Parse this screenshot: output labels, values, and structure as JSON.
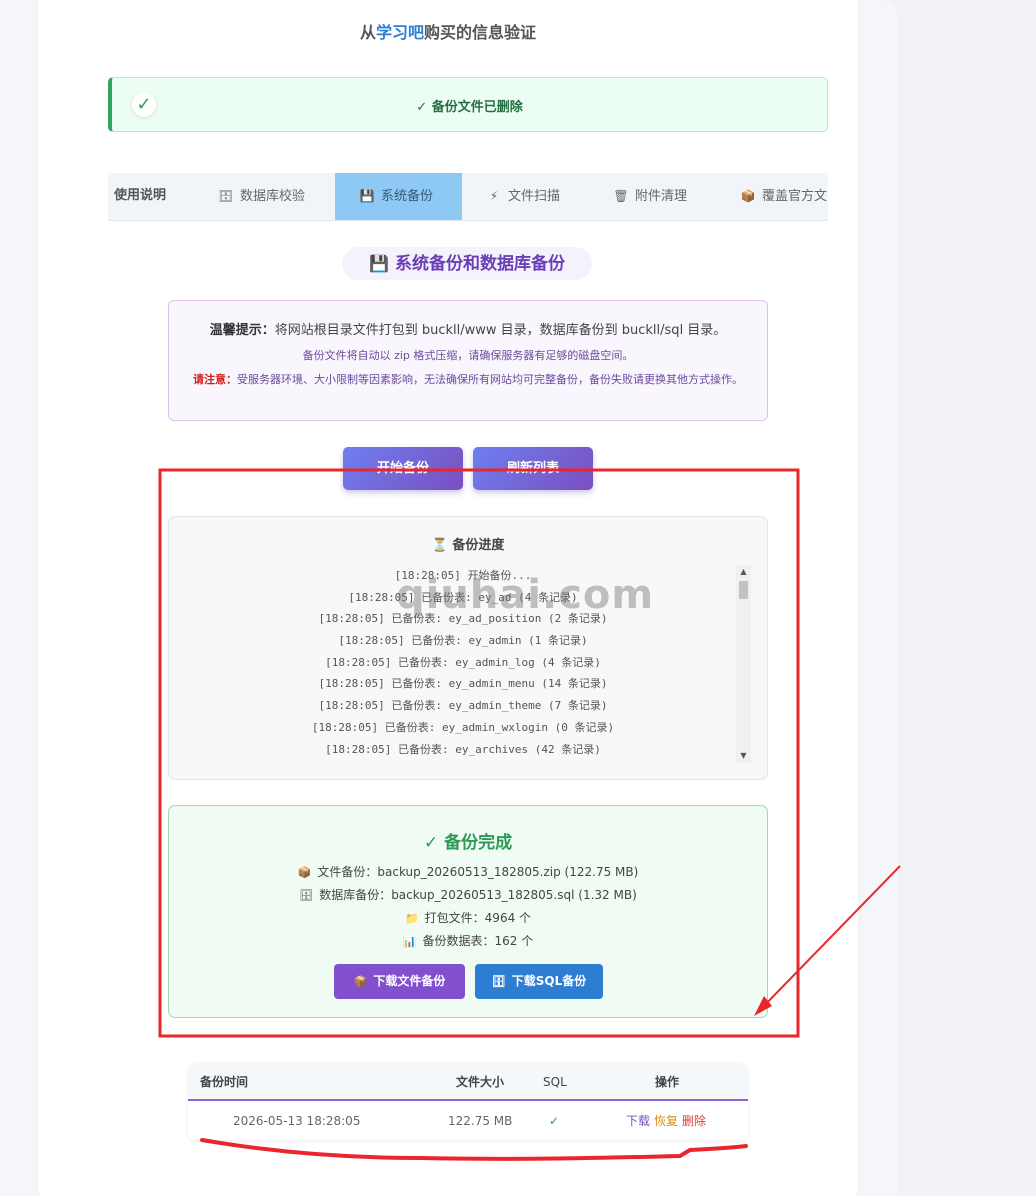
{
  "page": {
    "title_prefix": "从",
    "title_brand": "学习吧",
    "title_suffix": "购买的信息验证"
  },
  "alert": {
    "icon": "check-icon",
    "icon_glyph": "✓",
    "message": "✓ 备份文件已删除"
  },
  "tabs": [
    {
      "label": "使用说明",
      "icon": "",
      "active": false
    },
    {
      "label": "数据库校验",
      "icon": "database-icon",
      "glyph": "🗄",
      "active": false
    },
    {
      "label": "系统备份",
      "icon": "floppy-icon",
      "glyph": "💾",
      "active": true
    },
    {
      "label": "文件扫描",
      "icon": "lightning-icon",
      "glyph": "⚡",
      "active": false
    },
    {
      "label": "附件清理",
      "icon": "trash-icon",
      "glyph": "🗑",
      "active": false
    },
    {
      "label": "覆盖官方文",
      "icon": "package-icon",
      "glyph": "📦",
      "active": false
    }
  ],
  "section": {
    "glyph": "💾",
    "title": "系统备份和数据库备份"
  },
  "notice": {
    "tip_label": "温馨提示：",
    "tip_text": "将网站根目录文件打包到 buckll/www 目录，数据库备份到 buckll/sql 目录。",
    "line2": "备份文件将自动以 zip 格式压缩，请确保服务器有足够的磁盘空间。",
    "warn_label": "请注意：",
    "warn_text": "受服务器环境、大小限制等因素影响，无法确保所有网站均可完整备份，备份失败请更换其他方式操作。"
  },
  "actions": {
    "start_backup": "开始备份",
    "refresh_list": "刷新列表"
  },
  "progress": {
    "glyph": "⏳",
    "title": "备份进度",
    "log": [
      "[18:28:05] 开始备份...",
      "[18:28:05] 已备份表: ey_ad (4 条记录)",
      "[18:28:05] 已备份表: ey_ad_position (2 条记录)",
      "[18:28:05] 已备份表: ey_admin (1 条记录)",
      "[18:28:05] 已备份表: ey_admin_log (4 条记录)",
      "[18:28:05] 已备份表: ey_admin_menu (14 条记录)",
      "[18:28:05] 已备份表: ey_admin_theme (7 条记录)",
      "[18:28:05] 已备份表: ey_admin_wxlogin (0 条记录)",
      "[18:28:05] 已备份表: ey_archives (42 条记录)"
    ]
  },
  "done": {
    "title": "✓ 备份完成",
    "file_glyph": "📦",
    "file_line": "文件备份：backup_20260513_182805.zip (122.75 MB)",
    "db_glyph": "🗄",
    "db_line": "数据库备份：backup_20260513_182805.sql (1.32 MB)",
    "folder_glyph": "📁",
    "files_line": "打包文件：4964 个",
    "chart_glyph": "📊",
    "tables_line": "备份数据表：162 个",
    "download_files": "下载文件备份",
    "download_sql": "下载SQL备份"
  },
  "table": {
    "headers": {
      "time": "备份时间",
      "size": "文件大小",
      "sql": "SQL",
      "ops": "操作"
    },
    "rows": [
      {
        "time": "2026-05-13 18:28:05",
        "size": "122.75 MB",
        "sql": "✓",
        "download": "下载",
        "restore": "恢复",
        "delete": "删除"
      }
    ]
  },
  "watermark": "qiuhai.com",
  "colors": {
    "accent_purple": "#7a4fbf",
    "accent_blue": "#2d7dd2",
    "success_green": "#2c9a55",
    "annotation_red": "#e8262b"
  }
}
